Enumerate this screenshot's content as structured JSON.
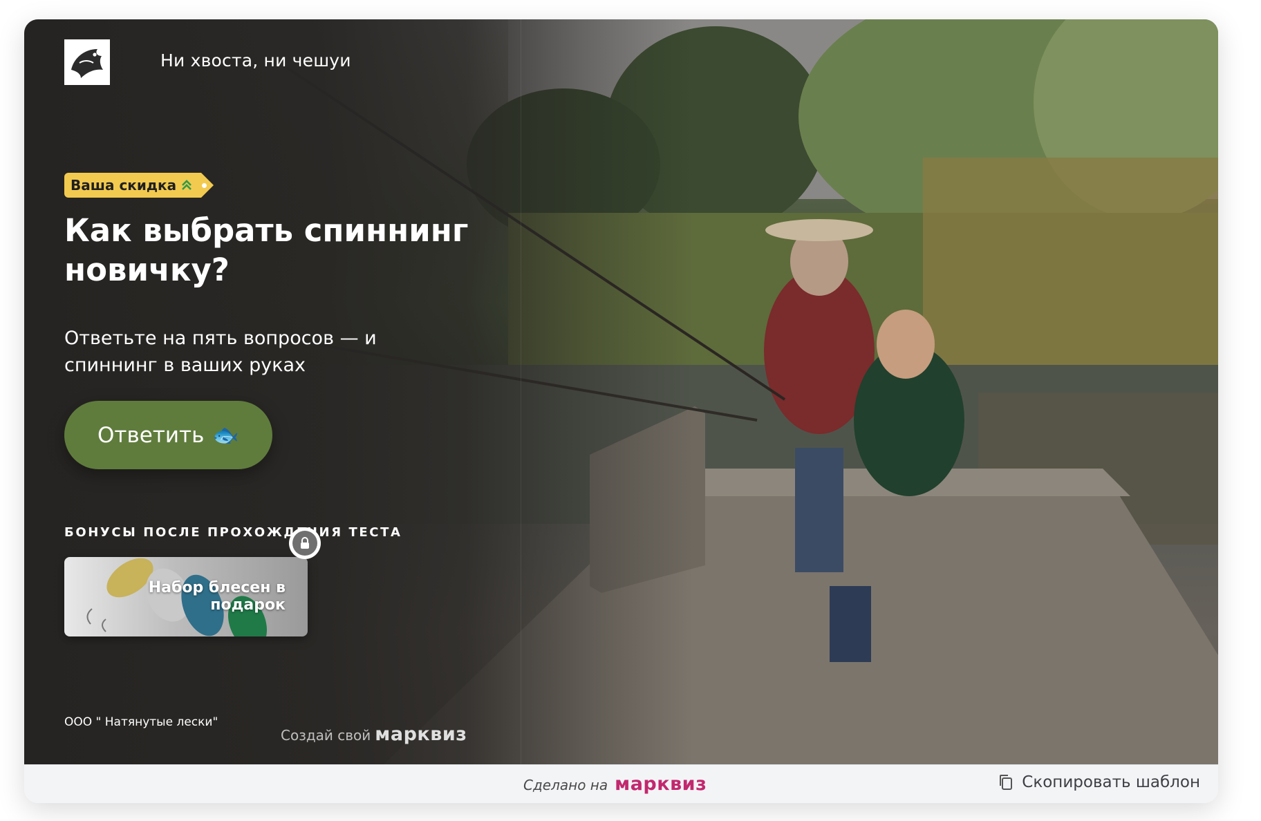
{
  "brand": {
    "tagline": "Ни хвоста, ни чешуи",
    "logo_icon": "fish-logo-icon"
  },
  "hero": {
    "discount_badge": "Ваша скидка",
    "headline": "Как выбрать спиннинг новичку?",
    "subtitle": "Ответьте на пять вопросов — и спиннинг в ваших руках",
    "cta_label": "Ответить",
    "cta_icon": "🐟"
  },
  "bonuses": {
    "heading": "БОНУСЫ ПОСЛЕ ПРОХОЖДЕНИЯ ТЕСТА",
    "items": [
      {
        "label": "Набор блесен в подарок",
        "locked": true
      }
    ]
  },
  "footer_left": {
    "company": "ООО \" Натянутые лески\"",
    "made_with_prefix": "Создай свой",
    "made_with_brand": "марквиз"
  },
  "footer_bar": {
    "made_on_label": "Сделано на",
    "made_on_brand": "марквиз",
    "copy_template_label": "Скопировать шаблон"
  },
  "colors": {
    "accent_button": "#5f7c3c",
    "badge": "#f2ca4f",
    "brand_pink": "#c2286e"
  }
}
